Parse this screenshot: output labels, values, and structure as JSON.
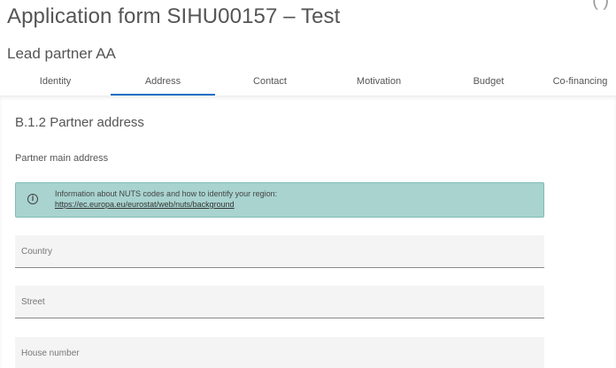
{
  "header": {
    "title": "Application form SIHU00157 – Test",
    "subtitle": "Lead partner AA",
    "corner_glyph": "( )"
  },
  "tabs": [
    {
      "label": "Identity",
      "active": false
    },
    {
      "label": "Address",
      "active": true
    },
    {
      "label": "Contact",
      "active": false
    },
    {
      "label": "Motivation",
      "active": false
    },
    {
      "label": "Budget",
      "active": false
    },
    {
      "label": "Co-financing",
      "active": false
    }
  ],
  "section": {
    "title": "B.1.2 Partner address",
    "main_address_label": "Partner main address"
  },
  "info_box": {
    "icon": "info-circle-icon",
    "text": "Information about NUTS codes and how to identify your region:",
    "link": "https://ec.europa.eu/eurostat/web/nuts/background",
    "background_color": "#a8d3cf"
  },
  "fields": {
    "country": {
      "label": "Country",
      "value": ""
    },
    "street": {
      "label": "Street",
      "value": ""
    },
    "house_number": {
      "label": "House number",
      "value": ""
    }
  },
  "colors": {
    "accent": "#1e6fc6",
    "info_border": "#7ebcb7",
    "field_background": "#f4f4f4"
  }
}
